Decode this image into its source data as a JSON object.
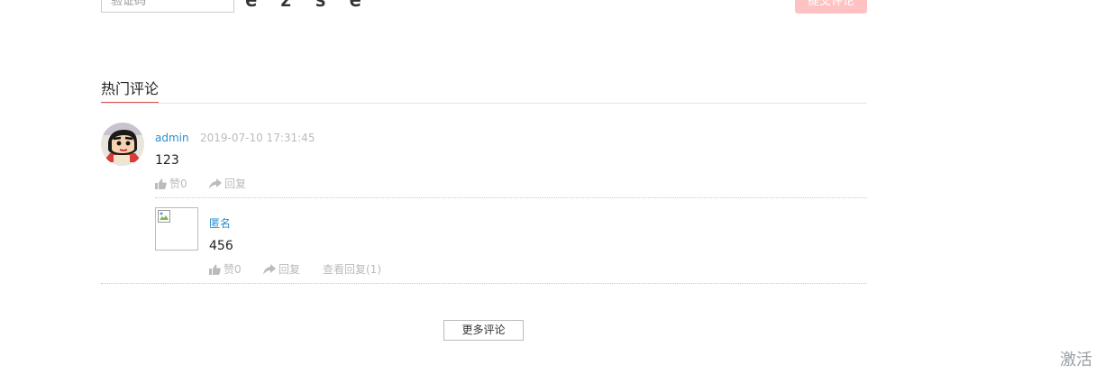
{
  "form": {
    "captcha_placeholder": "验证码",
    "captcha_code": "e z s e",
    "submit_label": "提交评论"
  },
  "section": {
    "title": "热门评论"
  },
  "comments": [
    {
      "user": "admin",
      "time": "2019-07-10 17:31:45",
      "content": "123",
      "like_label": "赞0",
      "reply_label": "回复",
      "avatar_icon": "cartoon-avatar"
    }
  ],
  "replies": [
    {
      "user": "匿名",
      "content": "456",
      "like_label": "赞0",
      "reply_label": "回复",
      "view_replies_label": "查看回复(1)",
      "avatar_icon": "broken-image-icon"
    }
  ],
  "more_label": "更多评论",
  "activate_label": "激活",
  "colors": {
    "accent": "#d9534f",
    "link": "#2a8fd1",
    "muted": "#bbbbbb",
    "submit_bg": "#ffc2c2"
  },
  "icons": {
    "like": "thumbs-up-icon",
    "reply": "share-arrow-icon"
  }
}
